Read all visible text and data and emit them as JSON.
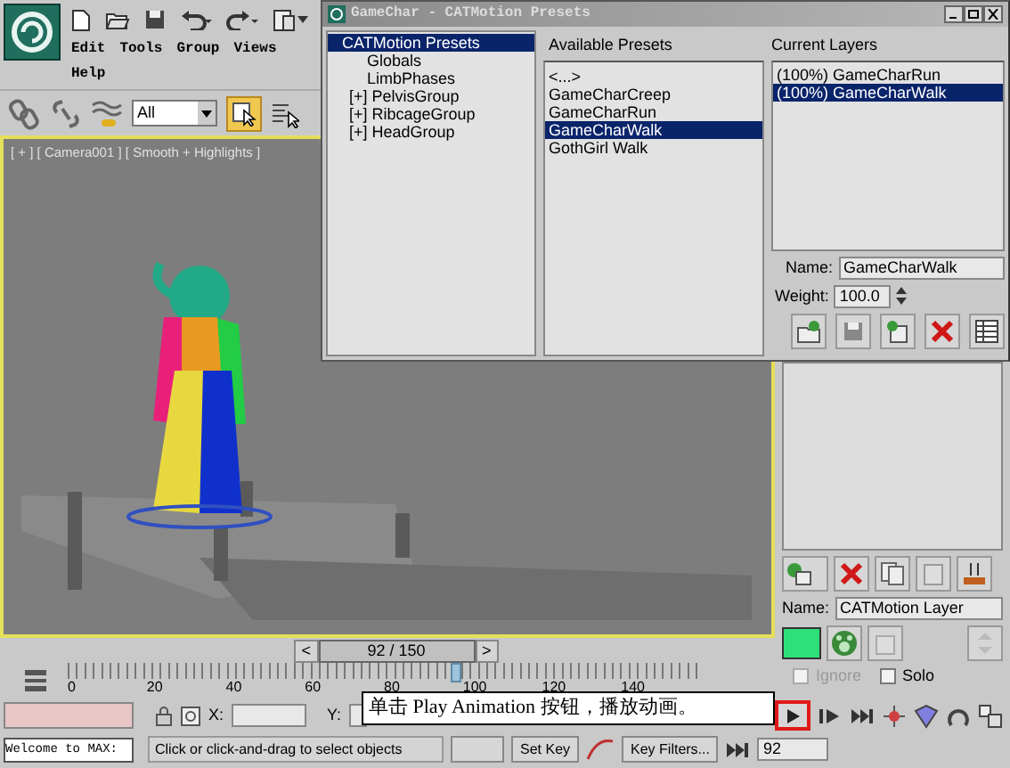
{
  "menu": {
    "items": [
      "Edit",
      "Tools",
      "Group",
      "Views",
      "Help"
    ]
  },
  "toolbar": {
    "selection_filter": "All",
    "select_active": true
  },
  "viewport": {
    "label": "[ + ] [ Camera001 ] [ Smooth + Highlights ]"
  },
  "time_slider": {
    "prev": "<",
    "position": "92 / 150",
    "next": ">"
  },
  "track_bar": {
    "ticks": [
      "0",
      "20",
      "40",
      "60",
      "80",
      "100",
      "120",
      "140"
    ],
    "level": 0.613
  },
  "command_panel": {
    "name_label": "Name:",
    "name_value": "CATMotion Layer",
    "checkboxes": [
      {
        "label": "Ignore",
        "checked": false,
        "disabled": true
      },
      {
        "label": "Solo",
        "checked": false,
        "disabled": false
      }
    ]
  },
  "status": {
    "listener": "Welcome to MAX:",
    "x_label": "X:",
    "y_label": "Y:",
    "prompt": "Click or click-and-drag to select objects",
    "set_key": "Set Key",
    "key_filters": "Key Filters...",
    "frame": "92",
    "play_highlighted": true
  },
  "presets_window": {
    "title": "GameChar - CATMotion Presets",
    "tree": [
      {
        "label": "CATMotion Presets",
        "selected": true,
        "children": [
          {
            "label": "Globals",
            "selected": false
          },
          {
            "label": "LimbPhases",
            "selected": false
          },
          {
            "expander": "[+]",
            "label": "PelvisGroup",
            "selected": false
          },
          {
            "expander": "[+]",
            "label": "RibcageGroup",
            "selected": false
          },
          {
            "expander": "[+]",
            "label": "HeadGroup",
            "selected": false
          }
        ]
      }
    ],
    "available_label": "Available Presets",
    "available": [
      {
        "label": "<...>",
        "selected": false
      },
      {
        "label": "GameCharCreep",
        "selected": false
      },
      {
        "label": "GameCharRun",
        "selected": false
      },
      {
        "label": "GameCharWalk",
        "selected": true
      },
      {
        "label": "GothGirl Walk",
        "selected": false
      }
    ],
    "layers_label": "Current Layers",
    "layers": [
      {
        "label": "(100%) GameCharRun",
        "selected": false
      },
      {
        "label": "(100%) GameCharWalk",
        "selected": true
      }
    ],
    "name_label": "Name:",
    "name_value": "GameCharWalk",
    "weight_label": "Weight:",
    "weight_value": "100.0"
  },
  "callout": {
    "text": "单击 Play Animation 按钮，播放动画。"
  }
}
